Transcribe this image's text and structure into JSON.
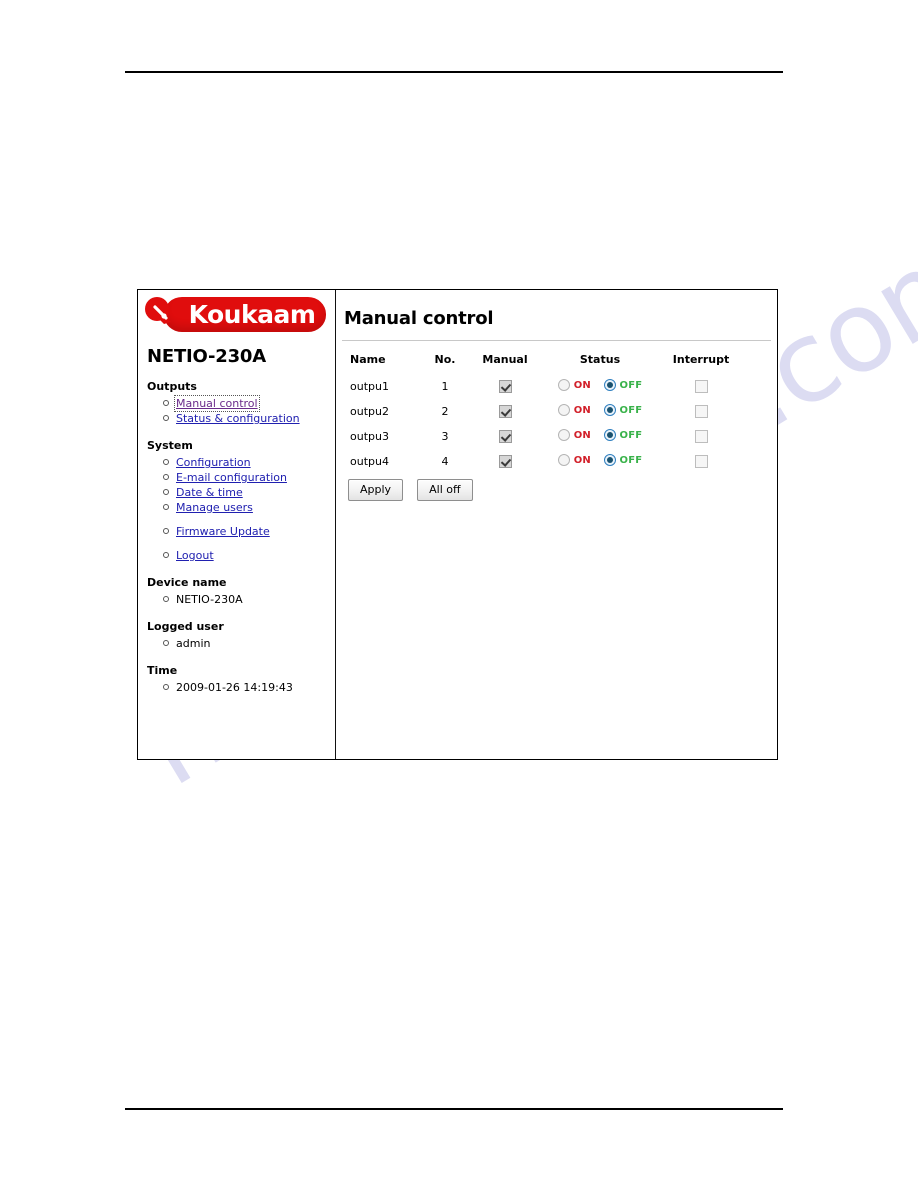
{
  "document": {
    "top_rule": true,
    "bottom_rule": true,
    "watermark_text": "manualshive.com"
  },
  "brand": {
    "logo_text": "Koukaam",
    "logo_color": "#e00d0d",
    "logo_text_color": "#ffffff"
  },
  "sidebar": {
    "device_title": "NETIO-230A",
    "sections": [
      {
        "title": "Outputs",
        "items": [
          {
            "label": "Manual control",
            "type": "link",
            "state": "focused-visited"
          },
          {
            "label": "Status & configuration",
            "type": "link",
            "state": "link"
          }
        ]
      },
      {
        "title": "System",
        "items": [
          {
            "label": "Configuration",
            "type": "link",
            "state": "link"
          },
          {
            "label": "E-mail configuration",
            "type": "link",
            "state": "link"
          },
          {
            "label": "Date & time",
            "type": "link",
            "state": "link"
          },
          {
            "label": "Manage users",
            "type": "link",
            "state": "link"
          },
          {
            "label": "Firmware Update",
            "type": "link",
            "state": "link",
            "gap": true
          },
          {
            "label": "Logout",
            "type": "link",
            "state": "link",
            "gap": true
          }
        ]
      },
      {
        "title": "Device name",
        "items": [
          {
            "label": "NETIO-230A",
            "type": "static"
          }
        ]
      },
      {
        "title": "Logged user",
        "items": [
          {
            "label": "admin",
            "type": "static"
          }
        ]
      },
      {
        "title": "Time",
        "items": [
          {
            "label": "2009-01-26 14:19:43",
            "type": "static"
          }
        ]
      }
    ]
  },
  "main": {
    "title": "Manual control",
    "table": {
      "headers": [
        "Name",
        "No.",
        "Manual",
        "Status",
        "Interrupt"
      ],
      "status_labels": {
        "on": "ON",
        "off": "OFF"
      },
      "rows": [
        {
          "name": "outpu1",
          "no": "1",
          "manual": true,
          "status": "OFF",
          "interrupt": false
        },
        {
          "name": "outpu2",
          "no": "2",
          "manual": true,
          "status": "OFF",
          "interrupt": false
        },
        {
          "name": "outpu3",
          "no": "3",
          "manual": true,
          "status": "OFF",
          "interrupt": false
        },
        {
          "name": "outpu4",
          "no": "4",
          "manual": true,
          "status": "OFF",
          "interrupt": false
        }
      ]
    },
    "buttons": {
      "apply": "Apply",
      "all_off": "All off"
    }
  },
  "colors": {
    "on_label": "#d2202a",
    "off_label": "#39b24a",
    "link": "#2020b0",
    "visited_link": "#6a2a8a",
    "watermark": "#dcdcf2"
  }
}
